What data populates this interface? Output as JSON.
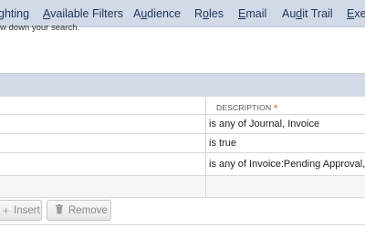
{
  "tabs": [
    {
      "pre": "",
      "u": "",
      "post": "ghting"
    },
    {
      "pre": "",
      "u": "A",
      "post": "vailable Filters"
    },
    {
      "pre": "A",
      "u": "u",
      "post": "dience"
    },
    {
      "pre": "R",
      "u": "o",
      "post": "les"
    },
    {
      "pre": "",
      "u": "E",
      "post": "mail"
    },
    {
      "pre": "Au",
      "u": "d",
      "post": "it Trail"
    },
    {
      "pre": "",
      "u": "E",
      "post": "xec"
    }
  ],
  "hint_text": "w down your search.",
  "table": {
    "description_header": "DESCRIPTION",
    "required_marker": "*",
    "rows": [
      {
        "description": "is any of Journal, Invoice"
      },
      {
        "description": "is true"
      },
      {
        "description": "is any of Invoice:Pending Approval, Jo"
      }
    ]
  },
  "buttons": {
    "insert_label": "Insert",
    "remove_label": "Remove"
  },
  "colors": {
    "tab_bar": "#d2dae8",
    "accent_required": "#e07020"
  }
}
